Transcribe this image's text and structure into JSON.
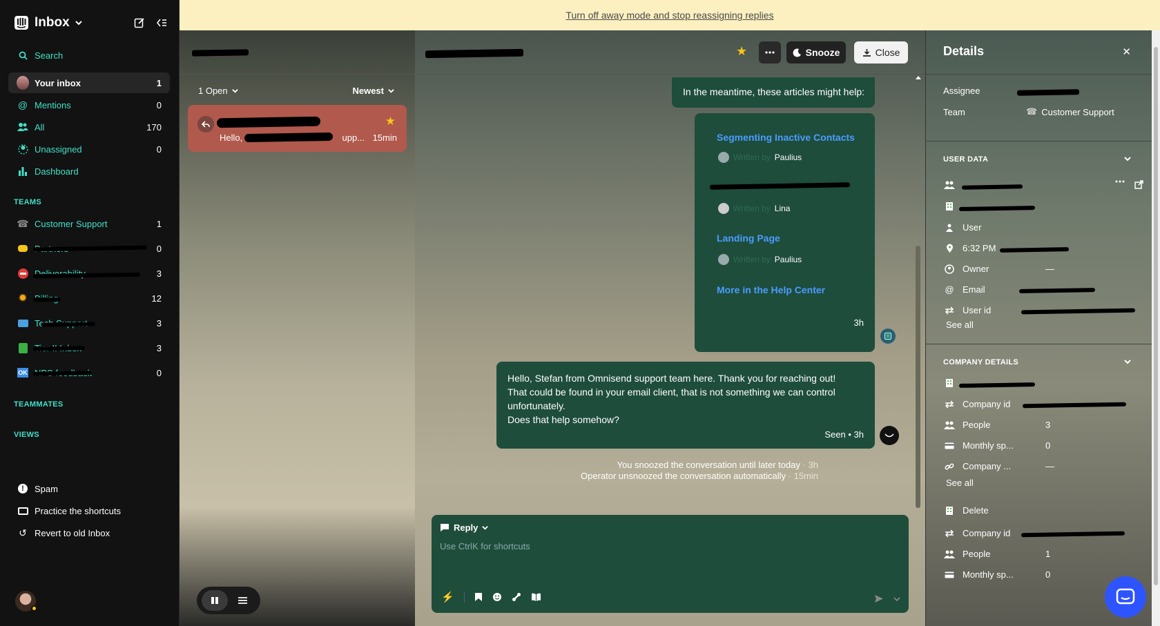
{
  "sidebar": {
    "title": "Inbox",
    "search": "Search",
    "items": [
      {
        "label": "Your inbox",
        "count": "1"
      },
      {
        "label": "Mentions",
        "count": "0"
      },
      {
        "label": "All",
        "count": "170"
      },
      {
        "label": "Unassigned",
        "count": "0"
      },
      {
        "label": "Dashboard",
        "count": ""
      }
    ],
    "teams_heading": "TEAMS",
    "teams": [
      {
        "label": "Customer Support",
        "count": "1",
        "icon": "phone-icon"
      },
      {
        "label": "Partners",
        "count": "0",
        "icon": "handshake-icon"
      },
      {
        "label": "Deliverability",
        "count": "3",
        "icon": "no-entry-icon"
      },
      {
        "label": "Billing",
        "count": "12",
        "icon": "sun-icon"
      },
      {
        "label": "Tech Support",
        "count": "3",
        "icon": "laptop-icon"
      },
      {
        "label": "Tier II Inbox",
        "count": "3",
        "icon": "green-book-icon"
      },
      {
        "label": "NPS feedback",
        "count": "0",
        "icon": "ok-icon"
      }
    ],
    "teammates_heading": "TEAMMATES",
    "views_heading": "VIEWS",
    "bottom": [
      {
        "label": "Spam",
        "icon": "alert-icon"
      },
      {
        "label": "Practice the shortcuts",
        "icon": "keyboard-icon"
      },
      {
        "label": "Revert to old Inbox",
        "icon": "revert-icon"
      }
    ]
  },
  "banner": {
    "text": "Turn off away mode and stop reassigning replies"
  },
  "list": {
    "filter_open": "1 Open",
    "sort": "Newest",
    "conversation": {
      "snippet_start": "Hello, S",
      "snippet_end": "upp...",
      "time": "15min"
    }
  },
  "conversation": {
    "actions": {
      "snooze": "Snooze",
      "close": "Close"
    },
    "intro": "In the meantime, these articles might help:",
    "written_by": "Written by",
    "articles": [
      {
        "title": "Segmenting Inactive Contacts",
        "author": "Paulius"
      },
      {
        "title": "",
        "author": "Lina"
      },
      {
        "title": "Landing Page",
        "author": "Paulius"
      }
    ],
    "more_link": "More in the Help Center",
    "articles_time": "3h",
    "reply_lines": [
      "Hello, Stefan from Omnisend support team here. Thank you for reaching out!",
      "That could be found in your email client, that is not something we can control",
      "unfortunately.",
      "Does that help somehow?"
    ],
    "reply_meta": "Seen • 3h",
    "events": [
      {
        "text": "You snoozed the conversation until later today",
        "time": " · 3h"
      },
      {
        "text": "Operator unsnoozed the conversation automatically",
        "time": " · 15min"
      }
    ],
    "composer": {
      "mode": "Reply",
      "placeholder": "Use CtrlK for shortcuts"
    }
  },
  "details": {
    "title": "Details",
    "assignee_label": "Assignee",
    "team_label": "Team",
    "team_value": "Customer Support",
    "user_data_heading": "USER DATA",
    "user_rows": [
      {
        "label": "",
        "value": ""
      },
      {
        "label": "",
        "value": ""
      },
      {
        "label": "User",
        "value": ""
      },
      {
        "label": "6:32 PM",
        "value": ""
      },
      {
        "label": "Owner",
        "value": "—"
      },
      {
        "label": "Email",
        "value": ""
      },
      {
        "label": "User id",
        "value": ""
      }
    ],
    "see_all": "See all",
    "company_heading": "COMPANY DETAILS",
    "company_rows": [
      {
        "label": "",
        "value": ""
      },
      {
        "label": "Company id",
        "value": ""
      },
      {
        "label": "People",
        "value": "3"
      },
      {
        "label": "Monthly sp...",
        "value": "0"
      },
      {
        "label": "Company ...",
        "value": "—"
      }
    ],
    "company2_rows": [
      {
        "label": "Delete",
        "value": ""
      },
      {
        "label": "Company id",
        "value": ""
      },
      {
        "label": "People",
        "value": "1"
      },
      {
        "label": "Monthly sp...",
        "value": "0"
      }
    ]
  }
}
